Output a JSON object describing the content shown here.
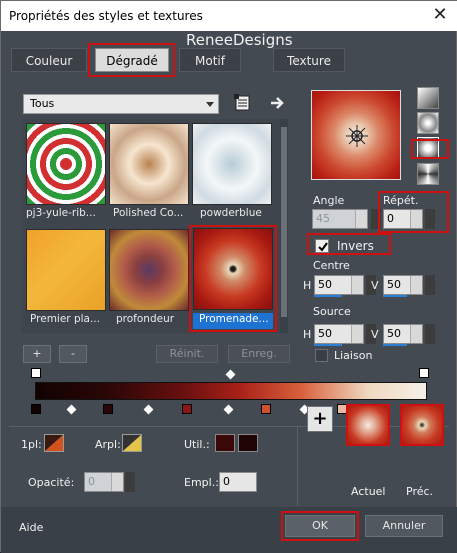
{
  "window": {
    "title": "Propriétés des styles et textures",
    "close_glyph": "✕",
    "brand": "ReneeDesigns"
  },
  "tabs": [
    {
      "label": "Couleur"
    },
    {
      "label": "Dégradé"
    },
    {
      "label": "Motif"
    },
    {
      "label": "Texture"
    }
  ],
  "library": {
    "category": "Tous",
    "items": [
      {
        "label": "pj3-yule-rib...",
        "selected": false
      },
      {
        "label": "Polished Co...",
        "selected": false
      },
      {
        "label": "powderblue",
        "selected": false
      },
      {
        "label": "Premier pla...",
        "selected": false
      },
      {
        "label": "profondeur",
        "selected": false
      },
      {
        "label": "Promenade...",
        "selected": true
      }
    ],
    "add_label": "+",
    "remove_label": "-",
    "reset_label": "Réinit.",
    "save_label": "Enreg."
  },
  "gradient": {
    "angle_label": "Angle",
    "angle_value": "45",
    "repeat_label": "Répét.",
    "repeat_value": "0",
    "invert_label": "Invers",
    "invert_checked": true,
    "center_label": "Centre",
    "center_h_label": "H",
    "center_h": "50",
    "center_v_label": "V",
    "center_v": "50",
    "source_label": "Source",
    "source_h_label": "H",
    "source_h": "50",
    "source_v_label": "V",
    "source_v": "50",
    "link_label": "Liaison",
    "link_checked": false
  },
  "bottom": {
    "first_label": "1pl:",
    "back_label": "Arpl:",
    "util_label": "Util.:",
    "opacity_label": "Opacité:",
    "opacity_value": "0",
    "position_label": "Empl.:",
    "position_value": "0",
    "current_label": "Actuel",
    "previous_label": "Préc.",
    "plus_glyph": "+"
  },
  "footer": {
    "help_label": "Aide",
    "ok_label": "OK",
    "cancel_label": "Annuler"
  },
  "colors": {
    "highlight_red": "#d01010",
    "selection_blue": "#1e73d2",
    "foreground": "#d2521c",
    "background": "#e4c449",
    "util_color": "#3a0808"
  },
  "icons": [
    "reset-icon",
    "arrow-right-icon",
    "crosshair-icon",
    "linear-icon",
    "rectangular-icon",
    "radial-icon",
    "sunburst-icon",
    "plus-icon",
    "checkmark-icon"
  ]
}
